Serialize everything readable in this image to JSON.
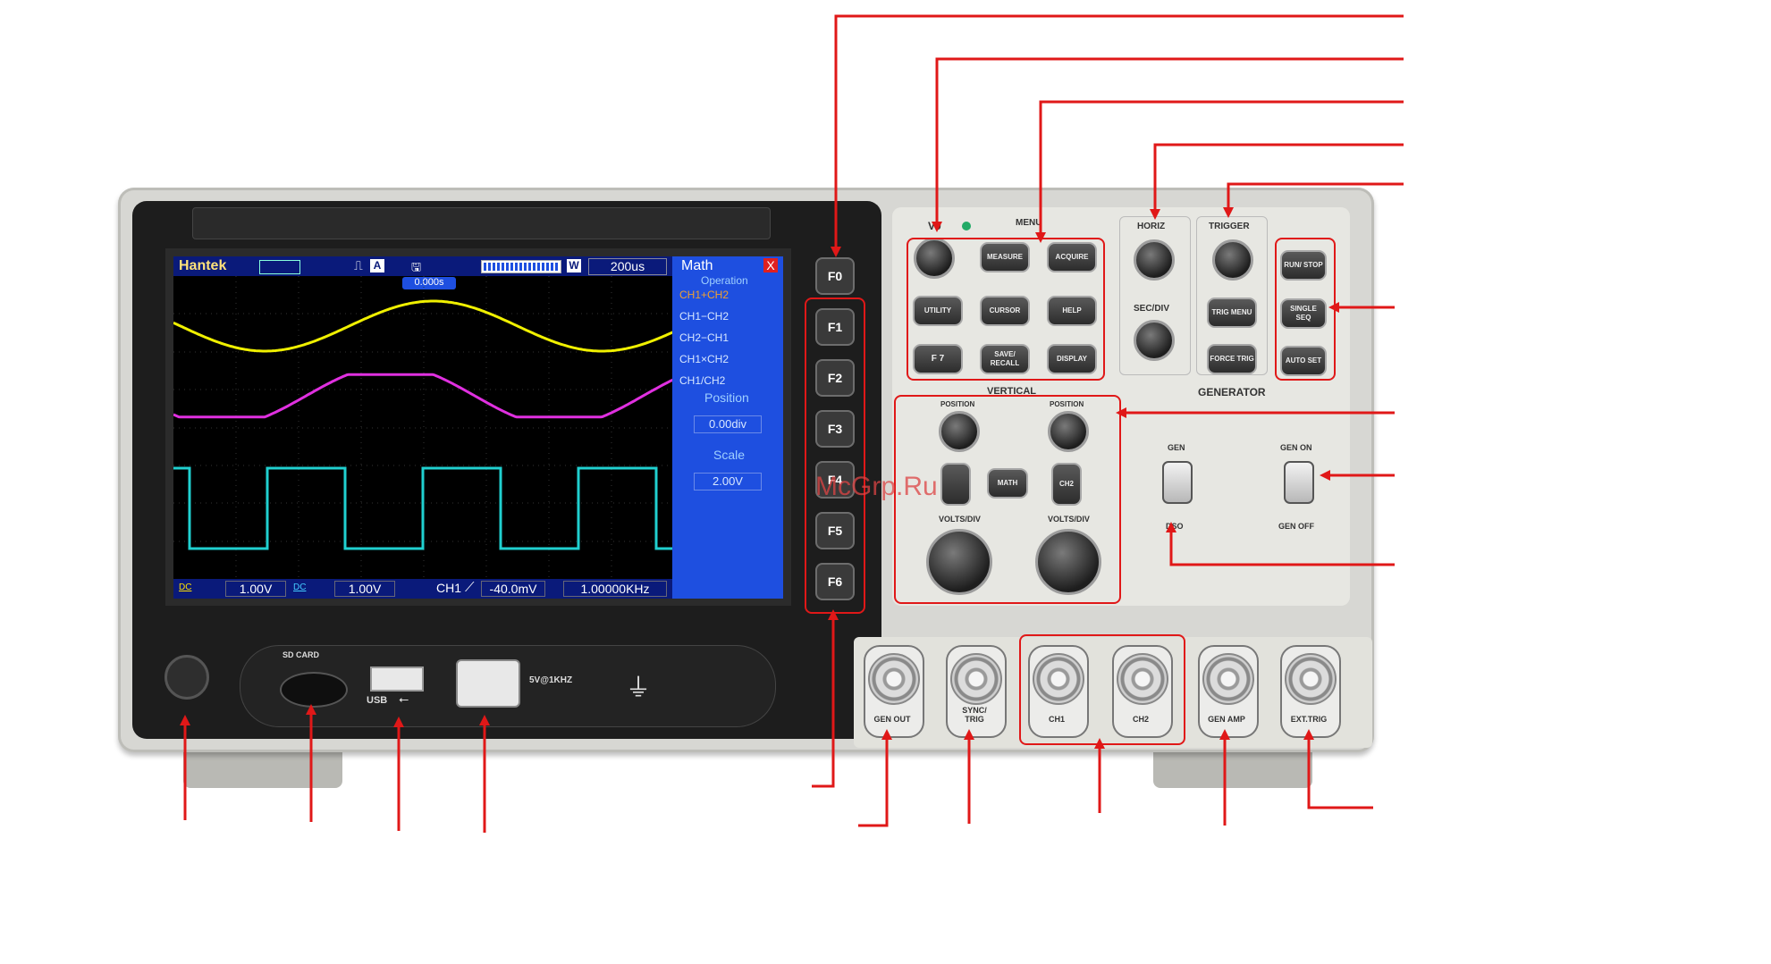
{
  "screen": {
    "brand": "Hantek",
    "run_badge": "A",
    "trigger_offset": "0.000s",
    "window_mode": "W",
    "timebase": "200us",
    "bottom": {
      "ch1_coupling": "DC",
      "ch1_scale": "1.00V",
      "ch2_coupling": "DC",
      "ch2_scale": "1.00V",
      "trigger_source": "CH1",
      "trigger_level": "-40.0mV",
      "frequency": "1.00000KHz"
    },
    "menu": {
      "title": "Math",
      "close": "X",
      "operation_label": "Operation",
      "options": [
        "CH1+CH2",
        "CH1−CH2",
        "CH2−CH1",
        "CH1×CH2",
        "CH1/CH2"
      ],
      "position_label": "Position",
      "position_value": "0.00div",
      "scale_label": "Scale",
      "scale_value": "2.00V"
    },
    "traces": {
      "ch1_color": "#f0f000",
      "ch2_color": "#e030e0",
      "math_color": "#20d0d0"
    }
  },
  "function_keys": [
    "F0",
    "F1",
    "F2",
    "F3",
    "F4",
    "F5",
    "F6"
  ],
  "controls": {
    "v0": "V0",
    "menu_label": "MENU",
    "menu_buttons": [
      "MEASURE",
      "ACQUIRE",
      "UTILITY",
      "CURSOR",
      "HELP",
      "F 7",
      "SAVE/ RECALL",
      "DISPLAY"
    ],
    "horiz": "HORIZ",
    "trigger": "TRIGGER",
    "sec_div": "SEC/DIV",
    "trig_menu": "TRIG MENU",
    "force_trig": "FORCE TRIG",
    "run_stop": "RUN/ STOP",
    "single_seq": "SINGLE SEQ",
    "auto_set": "AUTO SET",
    "vertical": "VERTICAL",
    "generator": "GENERATOR",
    "position": "POSITION",
    "math": "MATH",
    "ch2": "CH2",
    "volts_div": "VOLTS/DIV",
    "gen": "GEN",
    "dso": "DSO",
    "gen_on": "GEN ON",
    "gen_off": "GEN OFF"
  },
  "front": {
    "sd_card": "SD CARD",
    "usb": "USB",
    "probe_comp": "5V@1KHZ"
  },
  "connectors": [
    "GEN OUT",
    "SYNC/ TRIG",
    "CH1",
    "CH2",
    "GEN AMP",
    "EXT.TRIG"
  ],
  "watermark": "McGrp.Ru",
  "colors": {
    "callout": "#e01818",
    "device_body": "#d7d7d3",
    "menu_panel": "#1e4fe0"
  }
}
